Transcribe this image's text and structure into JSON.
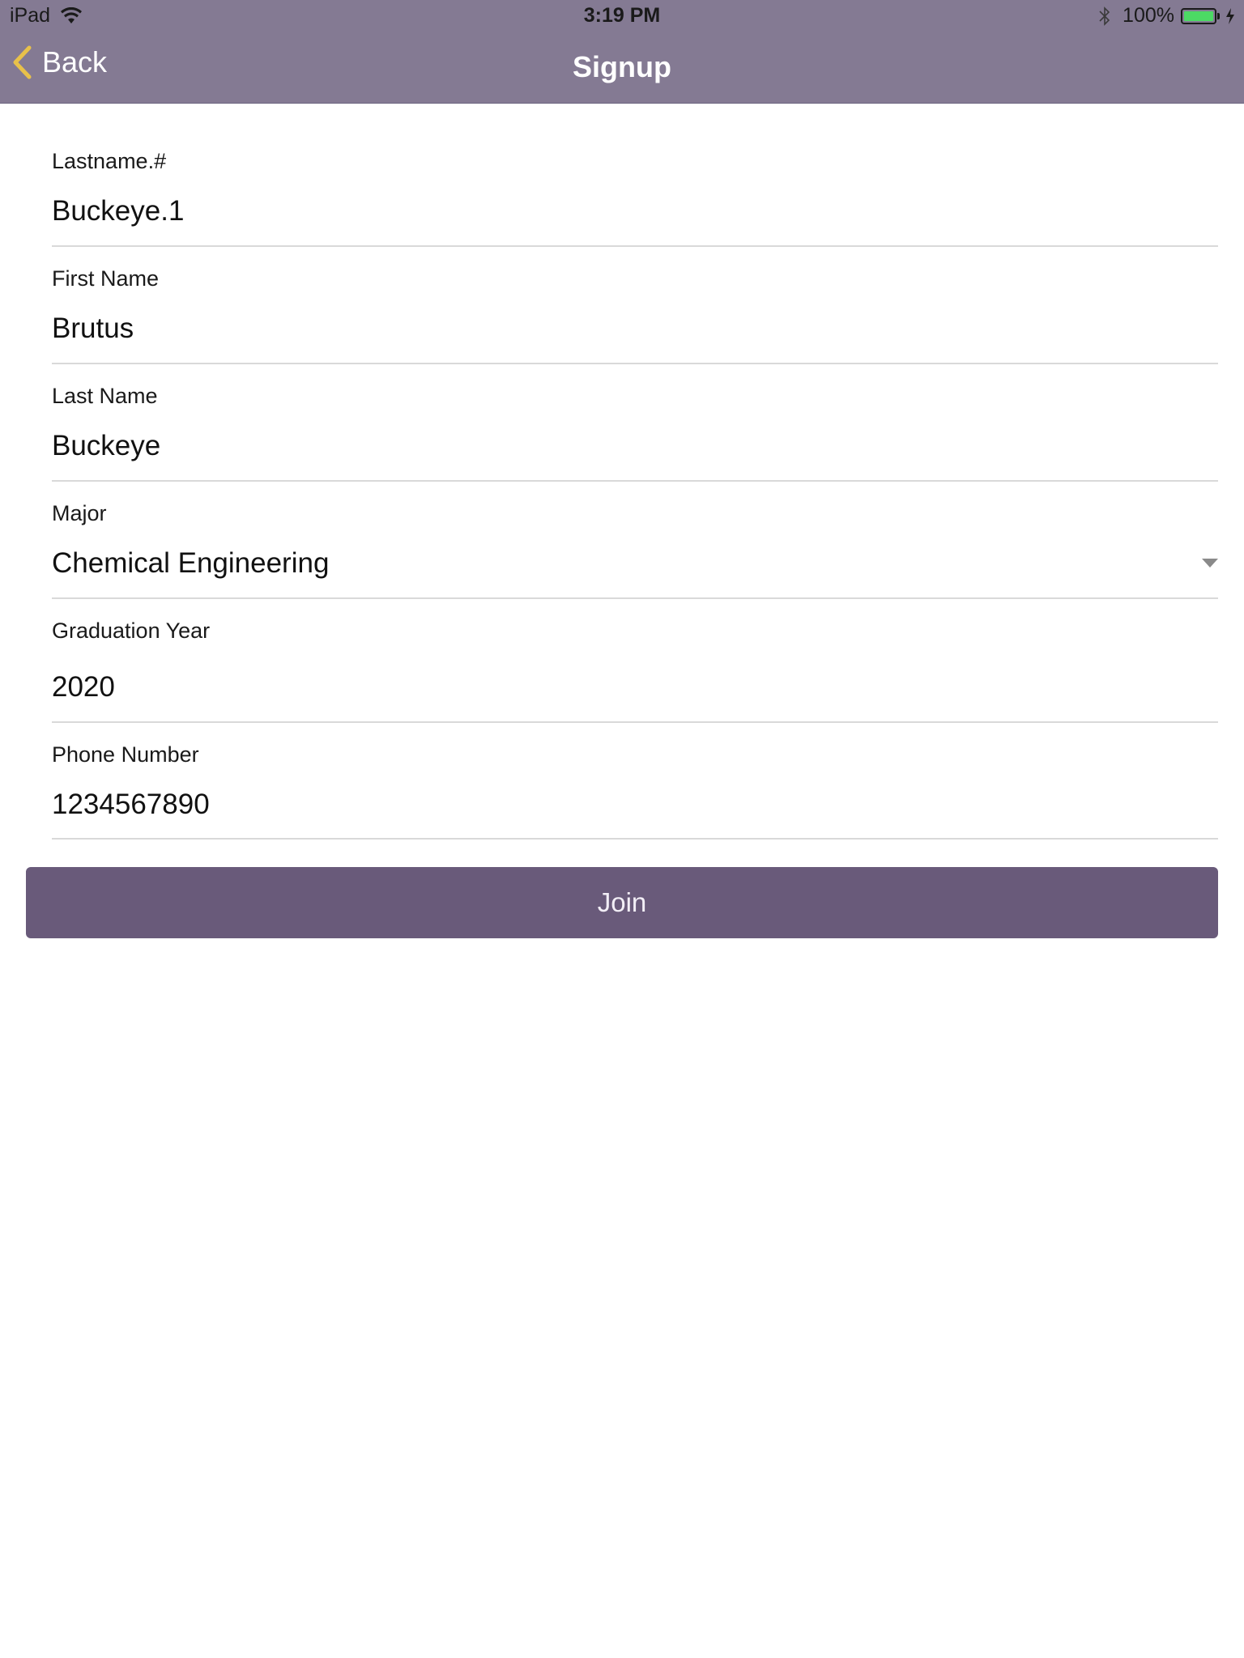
{
  "status_bar": {
    "device": "iPad",
    "time": "3:19 PM",
    "battery_percent": "100%",
    "battery_level": 1.0
  },
  "nav": {
    "back_label": "Back",
    "title": "Signup"
  },
  "fields": [
    {
      "label": "Lastname.#",
      "value": "Buckeye.1"
    },
    {
      "label": "First Name",
      "value": "Brutus"
    },
    {
      "label": "Last Name",
      "value": "Buckeye"
    },
    {
      "label": "Major",
      "value": "Chemical Engineering"
    },
    {
      "label": "Graduation Year",
      "value": "2020"
    },
    {
      "label": "Phone Number",
      "value": "1234567890"
    }
  ],
  "join_label": "Join",
  "icons": [
    "wifi-icon",
    "bluetooth-icon",
    "battery-icon",
    "charging-icon",
    "back-chevron-icon",
    "dropdown-arrow-icon"
  ],
  "colors": {
    "header_bg": "#847a93",
    "button_bg": "#695a7a",
    "back_chevron": "#e8c14a",
    "battery_fill": "#4cd964"
  }
}
